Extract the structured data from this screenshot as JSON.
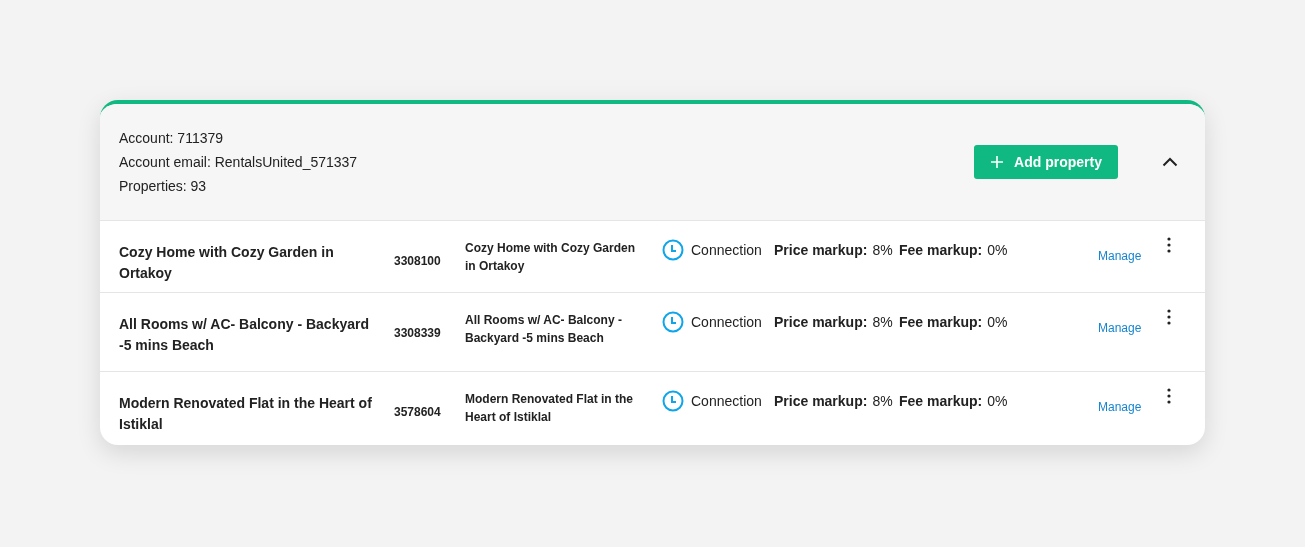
{
  "account": {
    "lines": [
      "Account: 711379",
      "Account email: RentalsUnited_571337",
      "Properties: 93"
    ],
    "add_button": "Add property",
    "expanded": true
  },
  "properties": [
    {
      "name": "Cozy Home with Cozy Garden in Ortakoy",
      "id": "3308100",
      "listing": "Cozy Home with Cozy Garden in Ortakoy",
      "status": "Connection",
      "price_label": "Price markup:",
      "price": "8%",
      "fee_label": "Fee markup:",
      "fee": "0%",
      "action": "Manage"
    },
    {
      "name": "All Rooms w/ AC- Balcony - Backyard -5 mins Beach",
      "id": "3308339",
      "listing": "All Rooms w/ AC- Balcony - Backyard -5 mins Beach",
      "status": "Connection",
      "price_label": "Price markup:",
      "price": "8%",
      "fee_label": "Fee markup:",
      "fee": "0%",
      "action": "Manage"
    },
    {
      "name": "Modern Renovated Flat in the Heart of Istiklal",
      "id": "3578604",
      "listing": "Modern Renovated Flat in the Heart of Istiklal",
      "status": "Connection",
      "price_label": "Price markup:",
      "price": "8%",
      "fee_label": "Fee markup:",
      "fee": "0%",
      "action": "Manage"
    }
  ]
}
